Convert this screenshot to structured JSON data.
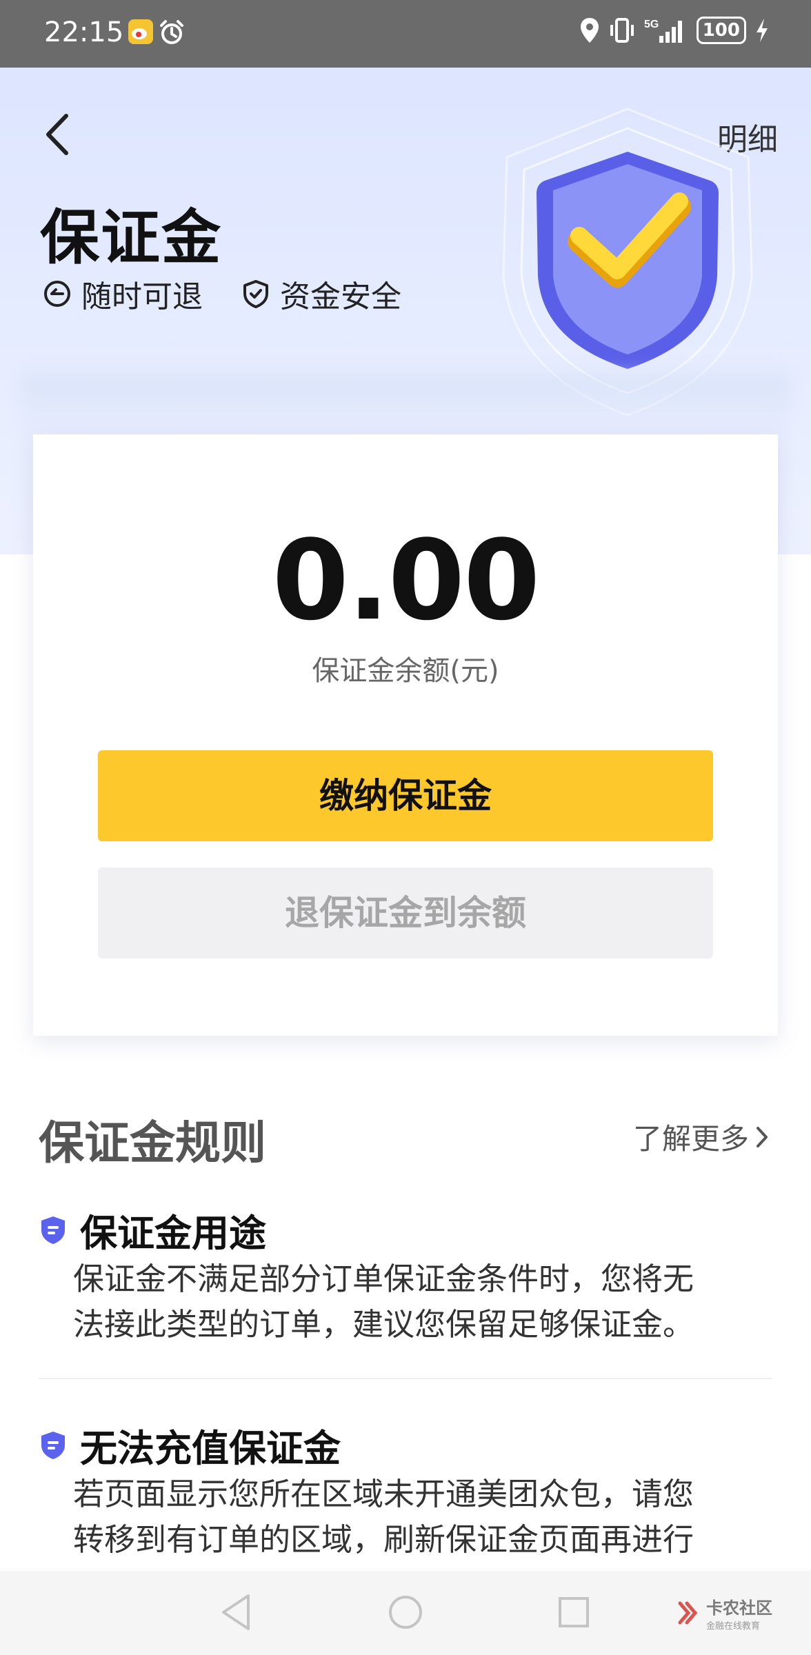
{
  "status_bar": {
    "time": "22:15",
    "icons": [
      "weibo-icon",
      "alarm-icon",
      "location-icon",
      "vibrate-icon",
      "signal-5g-icon",
      "battery-icon",
      "charging-icon"
    ],
    "network": "5G",
    "battery": "100"
  },
  "header": {
    "back_icon": "chevron-left-icon",
    "detail_label": "明细",
    "title": "保证金",
    "features": [
      {
        "icon": "refund-icon",
        "label": "随时可退"
      },
      {
        "icon": "shield-check-icon",
        "label": "资金安全"
      }
    ]
  },
  "balance": {
    "amount": "0.00",
    "label": "保证金余额(元)"
  },
  "actions": {
    "pay_label": "缴纳保证金",
    "refund_label": "退保证金到余额"
  },
  "rules": {
    "title": "保证金规则",
    "learn_more": "了解更多",
    "items": [
      {
        "title": "保证金用途",
        "lines": [
          "保证金不满足部分订单保证金条件时，您将无",
          "法接此类型的订单，建议您保留足够保证金。"
        ]
      },
      {
        "title": "无法充值保证金",
        "lines": [
          "若页面显示您所在区域未开通美团众包，请您",
          "转移到有订单的区域，刷新保证金页面再进行"
        ]
      }
    ]
  },
  "nav": {
    "buttons": [
      "back-triangle-icon",
      "home-circle-icon",
      "recents-square-icon"
    ]
  },
  "watermark": {
    "name": "卡农社区",
    "sub": "金融在线教育"
  },
  "colors": {
    "accent_yellow": "#fcc82c",
    "shield_blue": "#6a72f2",
    "hero_bg": "#e3e9ff",
    "disabled_bg": "#f0f0f2",
    "disabled_text": "#a6a6a6"
  }
}
